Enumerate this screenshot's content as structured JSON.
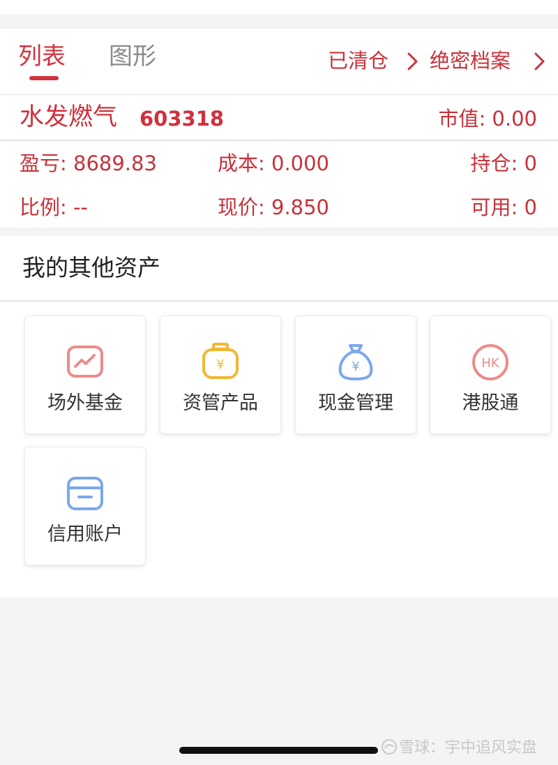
{
  "tabs": {
    "list_label": "列表",
    "chart_label": "图形"
  },
  "links": {
    "cleared": "已清仓",
    "archive": "绝密档案"
  },
  "stock": {
    "name": "水发燃气",
    "code": "603318",
    "market_value": "市值: 0.00"
  },
  "position": {
    "pnl": "盈亏: 8689.83",
    "cost": "成本: 0.000",
    "holding": "持仓: 0",
    "ratio": "比例: --",
    "price": "现价: 9.850",
    "available": "可用: 0"
  },
  "assets": {
    "title": "我的其他资产",
    "items": [
      {
        "label": "场外基金",
        "icon": "trend-chart-icon",
        "color": "#ee8a8a"
      },
      {
        "label": "资管产品",
        "icon": "yuan-bag-icon",
        "color": "#f2b632"
      },
      {
        "label": "现金管理",
        "icon": "money-bag-icon",
        "color": "#7aa8ec"
      },
      {
        "label": "港股通",
        "icon": "hk-circle-icon",
        "color": "#ee8a8a"
      },
      {
        "label": "信用账户",
        "icon": "credit-card-icon",
        "color": "#7aa8ec"
      }
    ]
  },
  "icon_glyphs": {
    "yuan": "¥",
    "hk": "HK"
  },
  "watermark": "雪球：宇中追风实盘",
  "colors": {
    "accent": "#d0303c",
    "background": "#f4f4f4",
    "card_border": "#ececec"
  }
}
